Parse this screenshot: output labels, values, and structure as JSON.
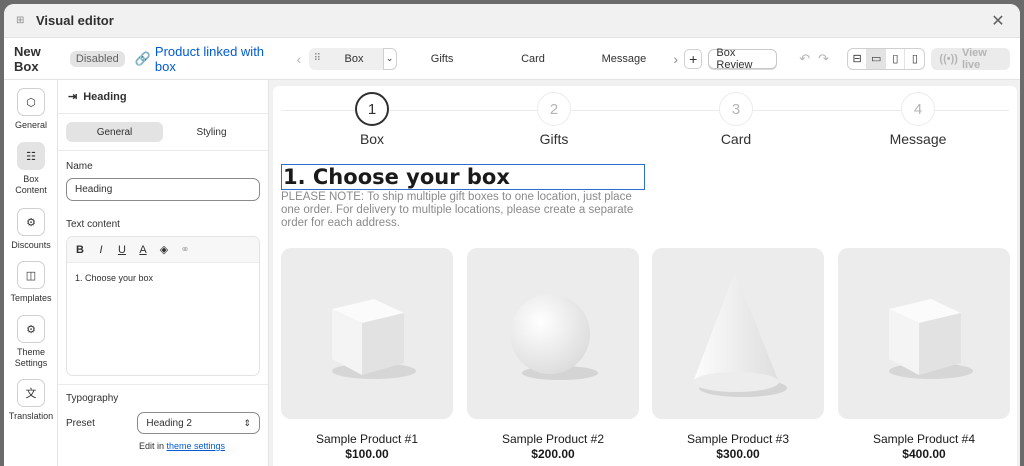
{
  "window": {
    "title": "Visual editor"
  },
  "toolbar": {
    "box_name": "New Box",
    "status_badge": "Disabled",
    "product_link": "Product linked with box",
    "selected_step": "Box",
    "steps": [
      "Gifts",
      "Card",
      "Message"
    ],
    "review_button": "Box Review",
    "view_live": "View live"
  },
  "rail": {
    "items": [
      {
        "label": "General",
        "icon": "cube-icon"
      },
      {
        "label": "Box Content",
        "icon": "list-icon"
      },
      {
        "label": "Discounts",
        "icon": "discount-icon"
      },
      {
        "label": "Templates",
        "icon": "template-icon"
      },
      {
        "label": "Theme Settings",
        "icon": "gear-icon"
      },
      {
        "label": "Translation",
        "icon": "translate-icon"
      }
    ],
    "active": "Box Content"
  },
  "panel": {
    "title": "Heading",
    "tabs": [
      "General",
      "Styling"
    ],
    "active_tab": "General",
    "name_label": "Name",
    "name_value": "Heading",
    "text_label": "Text content",
    "text_value": "1. Choose your box",
    "typography_label": "Typography",
    "preset_label": "Preset",
    "preset_value": "Heading 2",
    "edit_in": "Edit in",
    "theme_link": "theme settings"
  },
  "preview": {
    "steps": [
      {
        "num": "1",
        "label": "Box",
        "active": true
      },
      {
        "num": "2",
        "label": "Gifts",
        "active": false
      },
      {
        "num": "3",
        "label": "Card",
        "active": false
      },
      {
        "num": "4",
        "label": "Message",
        "active": false
      }
    ],
    "heading": "1. Choose your box",
    "note": "PLEASE NOTE: To ship multiple gift boxes to one location, just place one order. For delivery to multiple locations, please create a separate order for each address.",
    "products": [
      {
        "name": "Sample Product #1",
        "price": "$100.00",
        "shape": "cube"
      },
      {
        "name": "Sample Product #2",
        "price": "$200.00",
        "shape": "sphere"
      },
      {
        "name": "Sample Product #3",
        "price": "$300.00",
        "shape": "cone"
      },
      {
        "name": "Sample Product #4",
        "price": "$400.00",
        "shape": "cube"
      }
    ]
  }
}
